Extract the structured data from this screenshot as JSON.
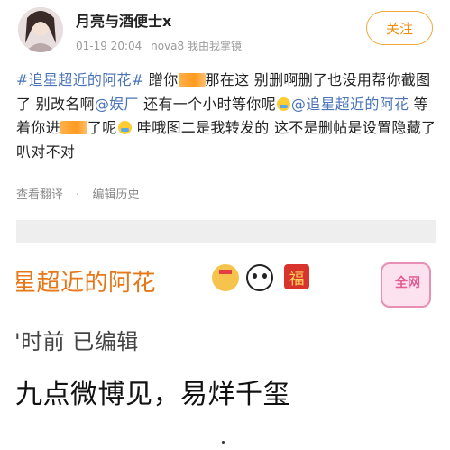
{
  "header": {
    "username": "月亮与酒便士x",
    "date": "01-19 20:04",
    "device": "nova8 我由我掌镜",
    "follow_label": "关注"
  },
  "post": {
    "hashtag1": "#追星超近的阿花#",
    "text1": " 蹭你",
    "text2": "那在这 别删啊删了也没用帮你截图了 别改名啊",
    "mention1": "@娱厂",
    "text3": " 还有一个小时等你呢",
    "mention2": "@追星超近的阿花",
    "text4": " 等着你进",
    "text5": "了呢",
    "text6": " 哇哦图二是我转发的 这不是删帖是设置隐藏了叭对不对"
  },
  "actions": {
    "translate": "查看翻译",
    "separator": "·",
    "edit_history": "编辑历史"
  },
  "card": {
    "name": "星超近的阿花",
    "fu": "福",
    "tv_label": "全网",
    "time": "'时前  已编辑",
    "text": "九点微博见，易烊千玺"
  }
}
